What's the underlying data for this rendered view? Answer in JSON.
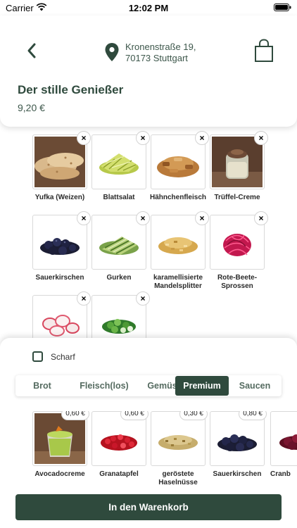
{
  "status": {
    "carrier": "Carrier",
    "time": "12:02 PM"
  },
  "header": {
    "address_line1": "Kronenstraße 19,",
    "address_line2": "70173 Stuttgart",
    "title": "Der stille Genießer",
    "price": "9,20 €"
  },
  "selected_items": [
    {
      "label": "Yufka (Weizen)",
      "remove": "×",
      "icon": "yufka-icon"
    },
    {
      "label": "Blattsalat",
      "remove": "×",
      "icon": "salad-icon"
    },
    {
      "label": "Hähnchenfleisch",
      "remove": "×",
      "icon": "chicken-icon"
    },
    {
      "label": "Trüffel-Creme",
      "remove": "×",
      "icon": "truffle-cream-icon"
    },
    {
      "label": "Sauerkirschen",
      "remove": "×",
      "icon": "cherries-icon"
    },
    {
      "label": "Gurken",
      "remove": "×",
      "icon": "cucumber-icon"
    },
    {
      "label": "karamellisierte Mandelsplitter",
      "remove": "×",
      "icon": "almond-icon"
    },
    {
      "label": "Rote-Beete-Sprossen",
      "remove": "×",
      "icon": "beet-sprouts-icon"
    },
    {
      "label": "",
      "remove": "×",
      "icon": "radish-icon"
    },
    {
      "label": "",
      "remove": "×",
      "icon": "spring-onion-icon"
    }
  ],
  "options": {
    "spicy_label": "Scharf"
  },
  "tabs": [
    {
      "label": "Brot",
      "active": false
    },
    {
      "label": "Fleisch(los)",
      "active": false
    },
    {
      "label": "Gemüse",
      "active": false
    },
    {
      "label": "Premium",
      "active": true
    },
    {
      "label": "Saucen",
      "active": false
    }
  ],
  "extras": [
    {
      "label": "Avocadocreme",
      "price": "0,60 €",
      "icon": "avocado-cream-icon"
    },
    {
      "label": "Granatapfel",
      "price": "0,60 €",
      "icon": "pomegranate-icon"
    },
    {
      "label": "geröstete Haselnüsse",
      "price": "0,30 €",
      "icon": "hazelnut-icon"
    },
    {
      "label": "Sauerkirschen",
      "price": "0,80 €",
      "icon": "cherries-icon"
    },
    {
      "label": "Cranb",
      "price": "",
      "icon": "cranberry-icon"
    }
  ],
  "cta": {
    "label": "In den Warenkorb"
  },
  "colors": {
    "primary": "#2f4a3d",
    "border": "#d9d9d9"
  }
}
